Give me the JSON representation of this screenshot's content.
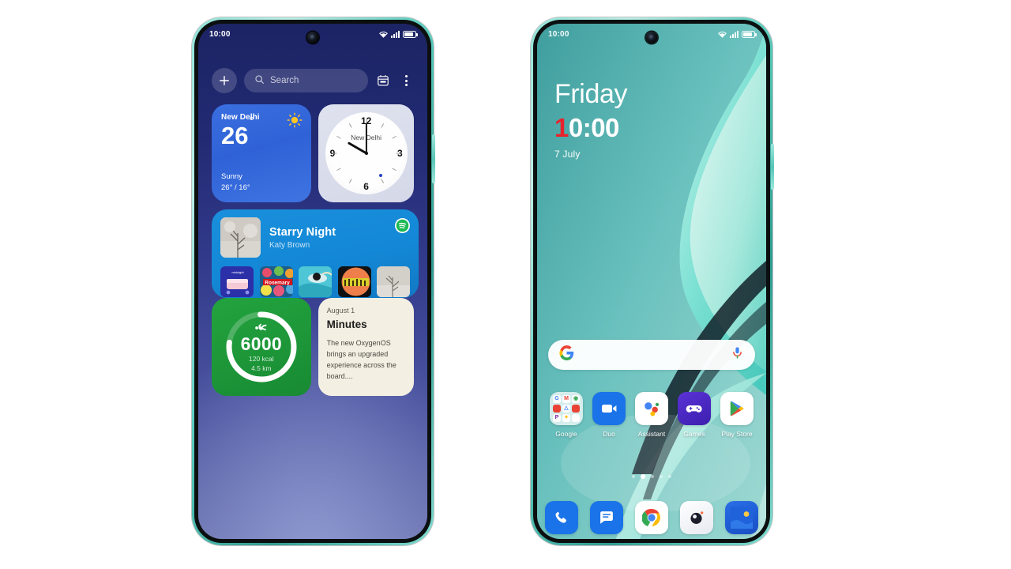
{
  "left_phone": {
    "device_name": "oneplus-phone-widgets-view",
    "status_bar": {
      "time": "10:00",
      "icons": [
        "wifi-icon",
        "signal-icon",
        "battery-icon"
      ]
    },
    "toolbar": {
      "add_label": "+",
      "search_placeholder": "Search",
      "calendar_icon": "calendar-icon",
      "overflow_icon": "more-vertical-icon"
    },
    "widgets": {
      "weather": {
        "city": "New Delhi",
        "temperature": "26",
        "degree": "°",
        "condition": "Sunny",
        "range": "26° / 16°",
        "icon": "sunny-icon",
        "color": "#3263d8"
      },
      "clock": {
        "label": "New Delhi",
        "numerals": [
          "12",
          "3",
          "6",
          "9"
        ],
        "time": "10:00"
      },
      "music": {
        "track_title": "Starry Night",
        "artist": "Katy Brown",
        "service_icon": "spotify-icon",
        "thumbnails": [
          "album-1",
          "album-2",
          "album-3",
          "album-4",
          "album-5"
        ],
        "color": "#1388d6"
      },
      "fitness": {
        "steps": "6000",
        "calories": "120 kcal",
        "distance": "4.5 km",
        "icon": "walking-icon",
        "progress_percent": 78,
        "color": "#1d9638"
      },
      "notes": {
        "date": "August 1",
        "title": "Minutes",
        "body": "The new OxygenOS brings an upgraded experience across the board....",
        "color": "#f3efe2"
      }
    }
  },
  "right_phone": {
    "device_name": "oneplus-phone-home-view",
    "status_bar": {
      "time": "10:00",
      "icons": [
        "wifi-icon",
        "signal-icon",
        "battery-icon"
      ]
    },
    "clock_widget": {
      "weekday": "Friday",
      "time_highlight": "1",
      "time_rest": "0:00",
      "date": "7 July",
      "highlight_color": "#e8232c"
    },
    "search_bar": {
      "logo": "google-g-icon",
      "mic_icon": "microphone-icon",
      "placeholder": ""
    },
    "apps": [
      {
        "label": "Google",
        "icon": "google-folder-icon"
      },
      {
        "label": "Duo",
        "icon": "duo-icon"
      },
      {
        "label": "Assistant",
        "icon": "google-assistant-icon"
      },
      {
        "label": "Games",
        "icon": "games-icon"
      },
      {
        "label": "Play Store",
        "icon": "play-store-icon"
      }
    ],
    "page_indicator": {
      "count": 5,
      "active_index": 1
    },
    "dock": [
      {
        "label": "Phone",
        "icon": "phone-icon"
      },
      {
        "label": "Messages",
        "icon": "messages-icon"
      },
      {
        "label": "Chrome",
        "icon": "chrome-icon"
      },
      {
        "label": "Camera",
        "icon": "camera-icon"
      },
      {
        "label": "Photos",
        "icon": "photos-icon"
      }
    ]
  }
}
